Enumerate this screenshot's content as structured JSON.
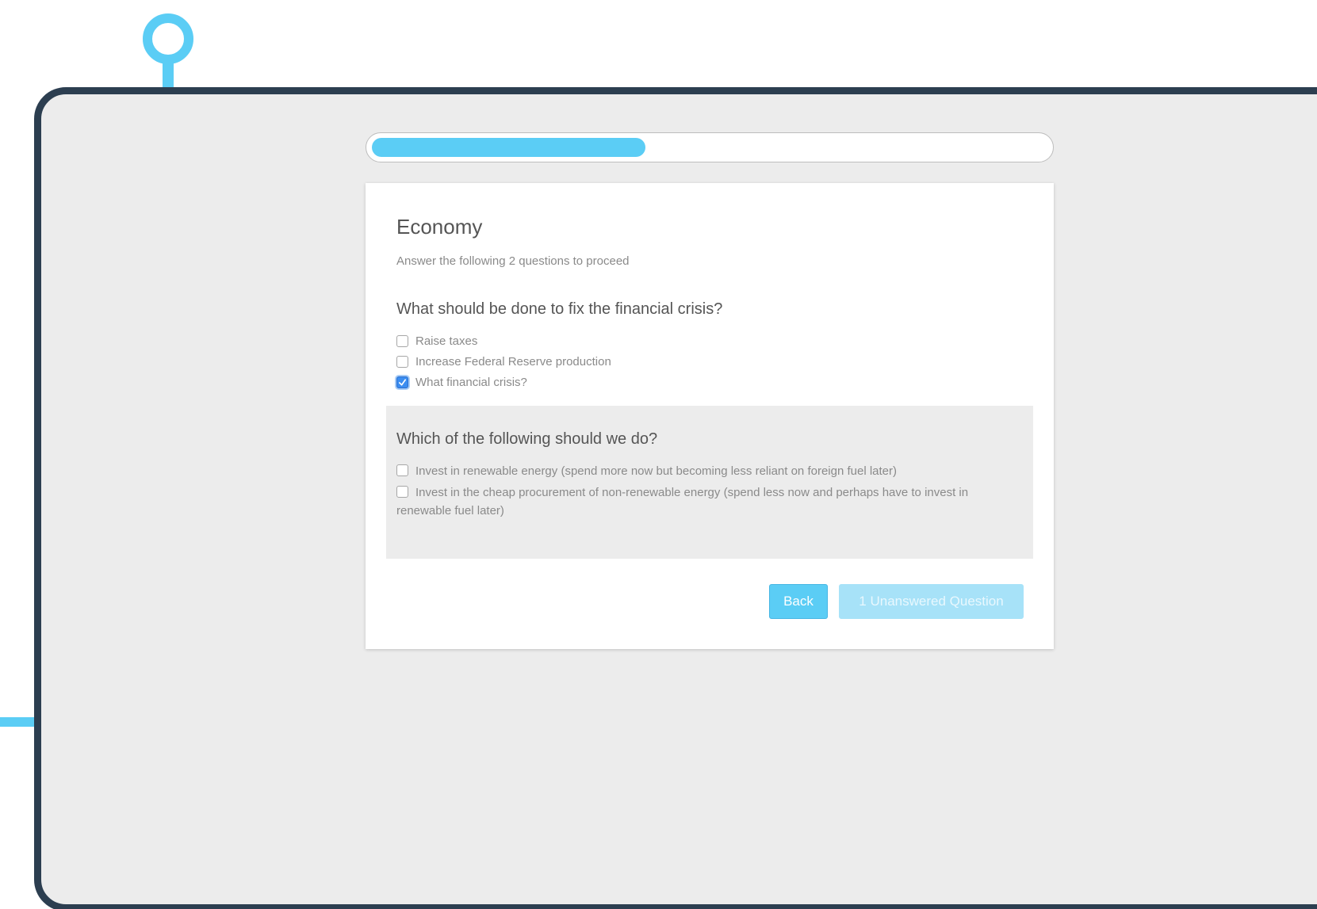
{
  "colors": {
    "accent": "#5bcdf5",
    "frame": "#2c3e50",
    "checked": "#3b8df0"
  },
  "progress": {
    "value": 0.405
  },
  "section": {
    "title": "Economy",
    "instructions": "Answer the following 2 questions to proceed"
  },
  "questions": [
    {
      "title": "What should be done to fix the financial crisis?",
      "options": [
        {
          "label": "Raise taxes",
          "checked": false
        },
        {
          "label": "Increase Federal Reserve production",
          "checked": false
        },
        {
          "label": "What financial crisis?",
          "checked": true
        }
      ]
    },
    {
      "title": "Which of the following should we do?",
      "options": [
        {
          "label": "Invest in renewable energy (spend more now but becoming less reliant on foreign fuel later)",
          "checked": false
        },
        {
          "label": "Invest in the cheap procurement of non-renewable energy (spend less now and perhaps have to invest in renewable fuel later)",
          "checked": false
        }
      ]
    }
  ],
  "actions": {
    "back_label": "Back",
    "next_label": "1 Unanswered Question"
  },
  "icons": {
    "pin": "location-pin-icon",
    "check": "checkmark-icon"
  }
}
